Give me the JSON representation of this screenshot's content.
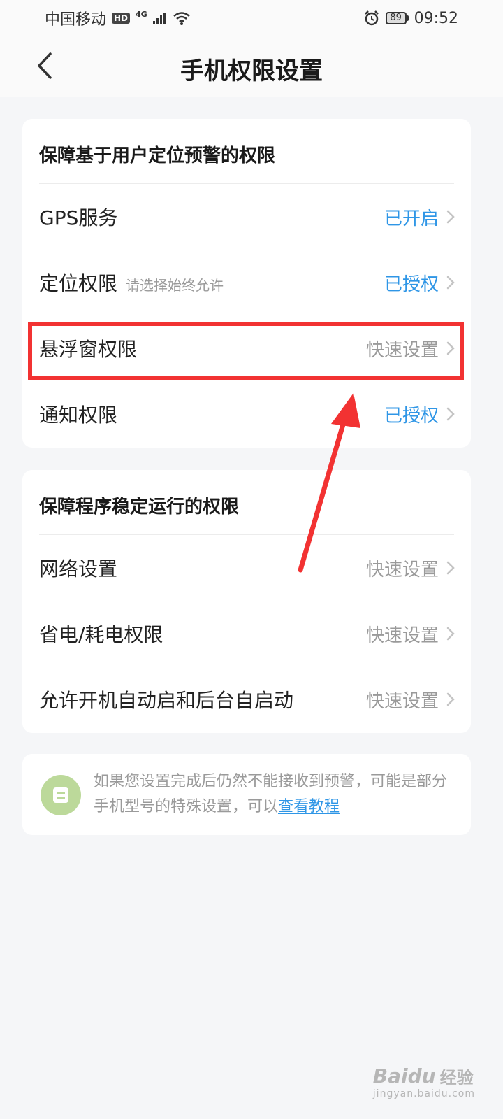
{
  "status_bar": {
    "carrier": "中国移动",
    "hd": "HD",
    "network": "4G",
    "battery": "89",
    "time": "09:52"
  },
  "nav": {
    "title": "手机权限设置"
  },
  "section_location": {
    "title": "保障基于用户定位预警的权限",
    "items": [
      {
        "label": "GPS服务",
        "hint": "",
        "status": "已开启"
      },
      {
        "label": "定位权限",
        "hint": "请选择始终允许",
        "status": "已授权"
      },
      {
        "label": "悬浮窗权限",
        "hint": "",
        "status": "快速设置"
      },
      {
        "label": "通知权限",
        "hint": "",
        "status": "已授权"
      }
    ]
  },
  "section_stability": {
    "title": "保障程序稳定运行的权限",
    "items": [
      {
        "label": "网络设置",
        "status": "快速设置"
      },
      {
        "label": "省电/耗电权限",
        "status": "快速设置"
      },
      {
        "label": "允许开机自动启和后台自启动",
        "status": "快速设置"
      }
    ]
  },
  "tip": {
    "text": "如果您设置完成后仍然不能接收到预警，可能是部分手机型号的特殊设置，可以",
    "link": "查看教程"
  },
  "watermark": {
    "brand": "Baidu",
    "label": "经验",
    "url": "jingyan.baidu.com"
  },
  "colors": {
    "accent": "#2f96e6",
    "highlight": "#f23232",
    "muted": "#9a9a9a"
  }
}
